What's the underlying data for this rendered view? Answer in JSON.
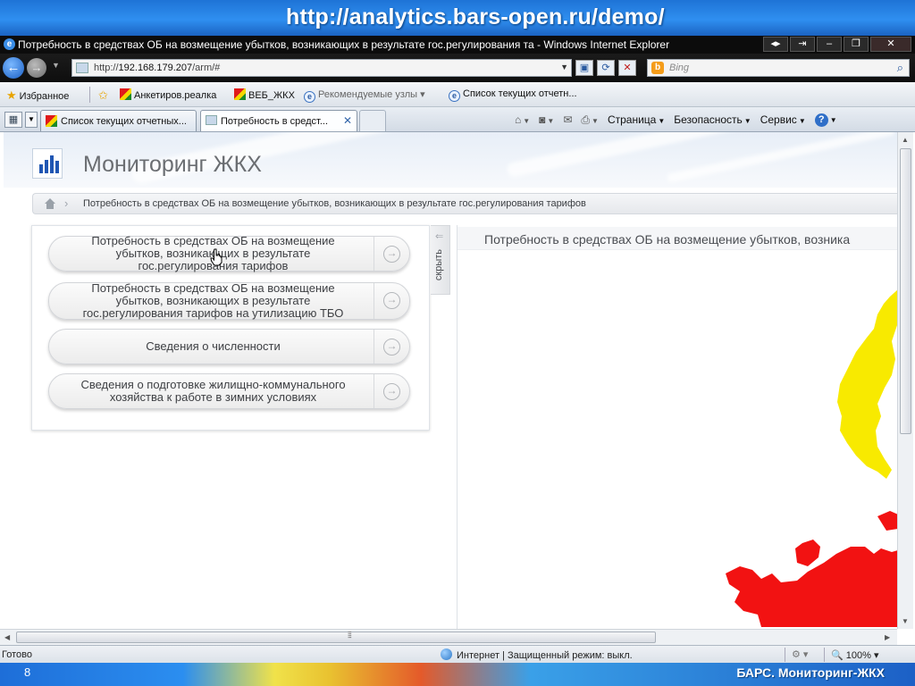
{
  "slide": {
    "url": "http://analytics.bars-open.ru/demo/",
    "page_number": "8",
    "brand": "БАРС. Мониторинг-ЖКХ"
  },
  "window": {
    "title": "Потребность в средствах ОБ на возмещение убытков, возникающих в результате гос.регулирования та - Windows Internet Explorer"
  },
  "address": {
    "prefix": "http://",
    "host": "192.168.179.207",
    "path": "/arm/#",
    "search_placeholder": "Bing"
  },
  "favorites": {
    "label": "Избранное",
    "items": [
      "Анкетиров.реалка",
      "ВЕБ_ЖКХ",
      "Рекомендуемые узлы ▾",
      "Список текущих отчетн..."
    ]
  },
  "tabs": [
    {
      "label": "Список текущих отчетных..."
    },
    {
      "label": "Потребность в средст..."
    }
  ],
  "commands": [
    "Страница",
    "Безопасность",
    "Сервис"
  ],
  "app": {
    "title": "Мониторинг ЖКХ",
    "breadcrumb": "Потребность в средствах ОБ на возмещение убытков, возникающих в результате гос.регулирования тарифов",
    "hide_label": "скрыть",
    "right_title": "Потребность в средствах ОБ на возмещение убытков, возника",
    "reports": [
      {
        "lines": [
          "Потребность в средствах ОБ на возмещение",
          "убытков, возникающих в результате",
          "гос.регулирования тарифов"
        ]
      },
      {
        "lines": [
          "Потребность в средствах ОБ на возмещение",
          "убытков, возникающих в результате",
          "гос.регулирования тарифов на утилизацию ТБО"
        ]
      },
      {
        "lines": [
          "Сведения о численности"
        ]
      },
      {
        "lines": [
          "Сведения о подготовке жилищно-коммунального",
          "хозяйства к работе в зимних условиях"
        ]
      }
    ]
  },
  "status": {
    "done": "Готово",
    "zone": "Интернет | Защищенный режим: выкл.",
    "zoom": "100%"
  },
  "colors": {
    "map_yellow": "#f8ea00",
    "map_red": "#f21212",
    "accent_blue": "#1f56b3"
  }
}
